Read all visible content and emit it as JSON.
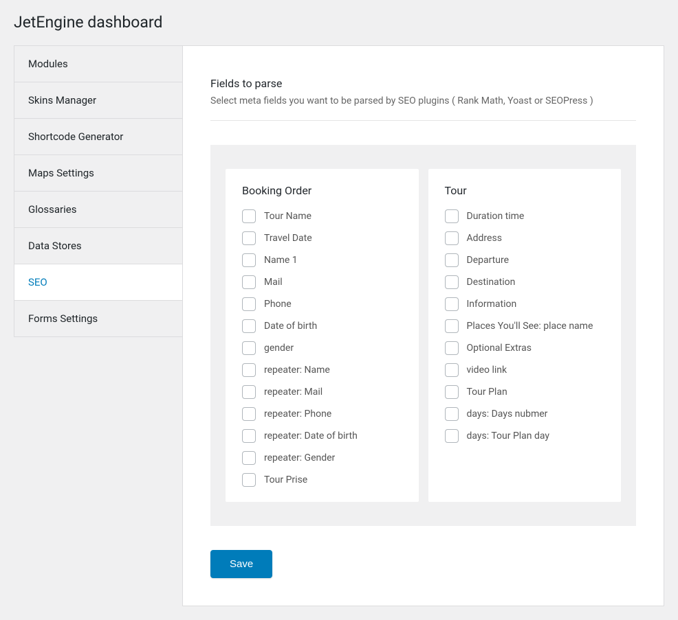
{
  "page_title": "JetEngine dashboard",
  "sidebar": {
    "items": [
      {
        "label": "Modules",
        "active": false
      },
      {
        "label": "Skins Manager",
        "active": false
      },
      {
        "label": "Shortcode Generator",
        "active": false
      },
      {
        "label": "Maps Settings",
        "active": false
      },
      {
        "label": "Glossaries",
        "active": false
      },
      {
        "label": "Data Stores",
        "active": false
      },
      {
        "label": "SEO",
        "active": true
      },
      {
        "label": "Forms Settings",
        "active": false
      }
    ]
  },
  "main": {
    "section_title": "Fields to parse",
    "section_desc": "Select meta fields you want to be parsed by SEO plugins ( Rank Math, Yoast or SEOPress )",
    "groups": [
      {
        "title": "Booking Order",
        "fields": [
          "Tour Name",
          "Travel Date",
          "Name 1",
          "Mail",
          "Phone",
          "Date of birth",
          "gender",
          "repeater: Name",
          "repeater: Mail",
          "repeater: Phone",
          "repeater: Date of birth",
          "repeater: Gender",
          "Tour Prise"
        ]
      },
      {
        "title": "Tour",
        "fields": [
          "Duration time",
          "Address",
          "Departure",
          "Destination",
          "Information",
          "Places You'll See: place name",
          "Optional Extras",
          "video link",
          "Tour Plan",
          "days: Days nubmer",
          "days: Tour Plan day"
        ]
      }
    ],
    "save_label": "Save"
  }
}
